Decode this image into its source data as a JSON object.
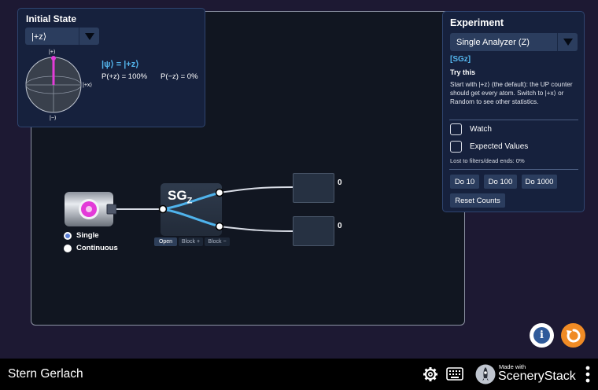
{
  "initial_state": {
    "title": "Initial State",
    "selected": "|+z⟩",
    "bloch": {
      "top": "|+⟩",
      "bottom": "|−⟩",
      "right": "|+x⟩"
    },
    "psi": "|ψ⟩ = |+z⟩",
    "p_plus": "P(+z) = 100%",
    "p_minus": "P(−z) = 0%"
  },
  "experiment": {
    "title": "Experiment",
    "selected": "Single Analyzer (Z)",
    "tag": "[SGz]",
    "try_title": "Try this",
    "try_text": "Start with |+z⟩ (the default): the UP counter should get every atom. Switch to |+x⟩ or Random to see other statistics.",
    "watch_label": "Watch",
    "expected_label": "Expected Values",
    "lost_text": "Lost to filters/dead ends: 0%",
    "buttons": [
      "Do 10",
      "Do 100",
      "Do 1000"
    ],
    "reset_counts": "Reset Counts"
  },
  "source": {
    "modes": [
      "Single",
      "Continuous"
    ],
    "selected_mode": "Single"
  },
  "sg_device": {
    "label": "SG",
    "axis": "Z",
    "buttons": [
      "Open",
      "Block +",
      "Block −"
    ],
    "active_button": "Open"
  },
  "detectors": [
    {
      "count": "0"
    },
    {
      "count": "0"
    }
  ],
  "navbar": {
    "title": "Stern Gerlach",
    "brand_small": "Made with",
    "brand_big": "SceneryStack"
  },
  "colors": {
    "accent_blue": "#54b5ec",
    "magenta": "#e33bd8",
    "orange": "#f08b25"
  }
}
